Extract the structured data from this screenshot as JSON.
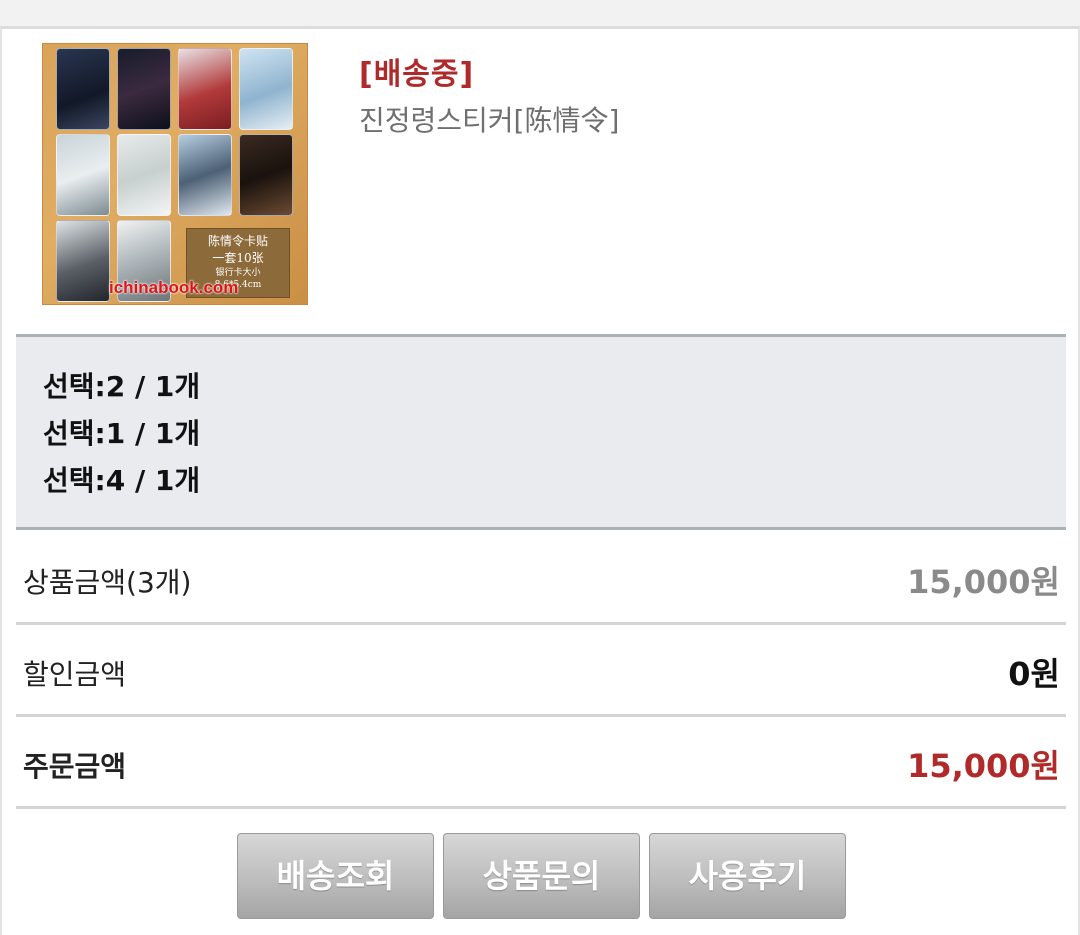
{
  "order_item": {
    "status": "[배송중]",
    "product_name": "진정령스티커[陈情令]",
    "thumbnail": {
      "caption_line1": "陈情令卡贴",
      "caption_line2": "一套10张",
      "caption_line3": "银行卡大小",
      "caption_line4": "8.6*5.4cm",
      "watermark": "ichinabook.com"
    },
    "options": [
      "선택:2 / 1개",
      "선택:1 / 1개",
      "선택:4 / 1개"
    ]
  },
  "summary": {
    "product_amount_label": "상품금액(3개)",
    "product_amount_value": "15,000원",
    "discount_label": "할인금액",
    "discount_value": "0원",
    "order_amount_label": "주문금액",
    "order_amount_value": "15,000원"
  },
  "actions": {
    "track_delivery": "배송조회",
    "product_inquiry": "상품문의",
    "review": "사용후기"
  },
  "colors": {
    "status": "#b02a2a",
    "order_amount": "#b02a2a",
    "product_amount": "#8a8a8a",
    "options_bg": "#e9ebee",
    "button_bg": "#bdbdbd"
  }
}
